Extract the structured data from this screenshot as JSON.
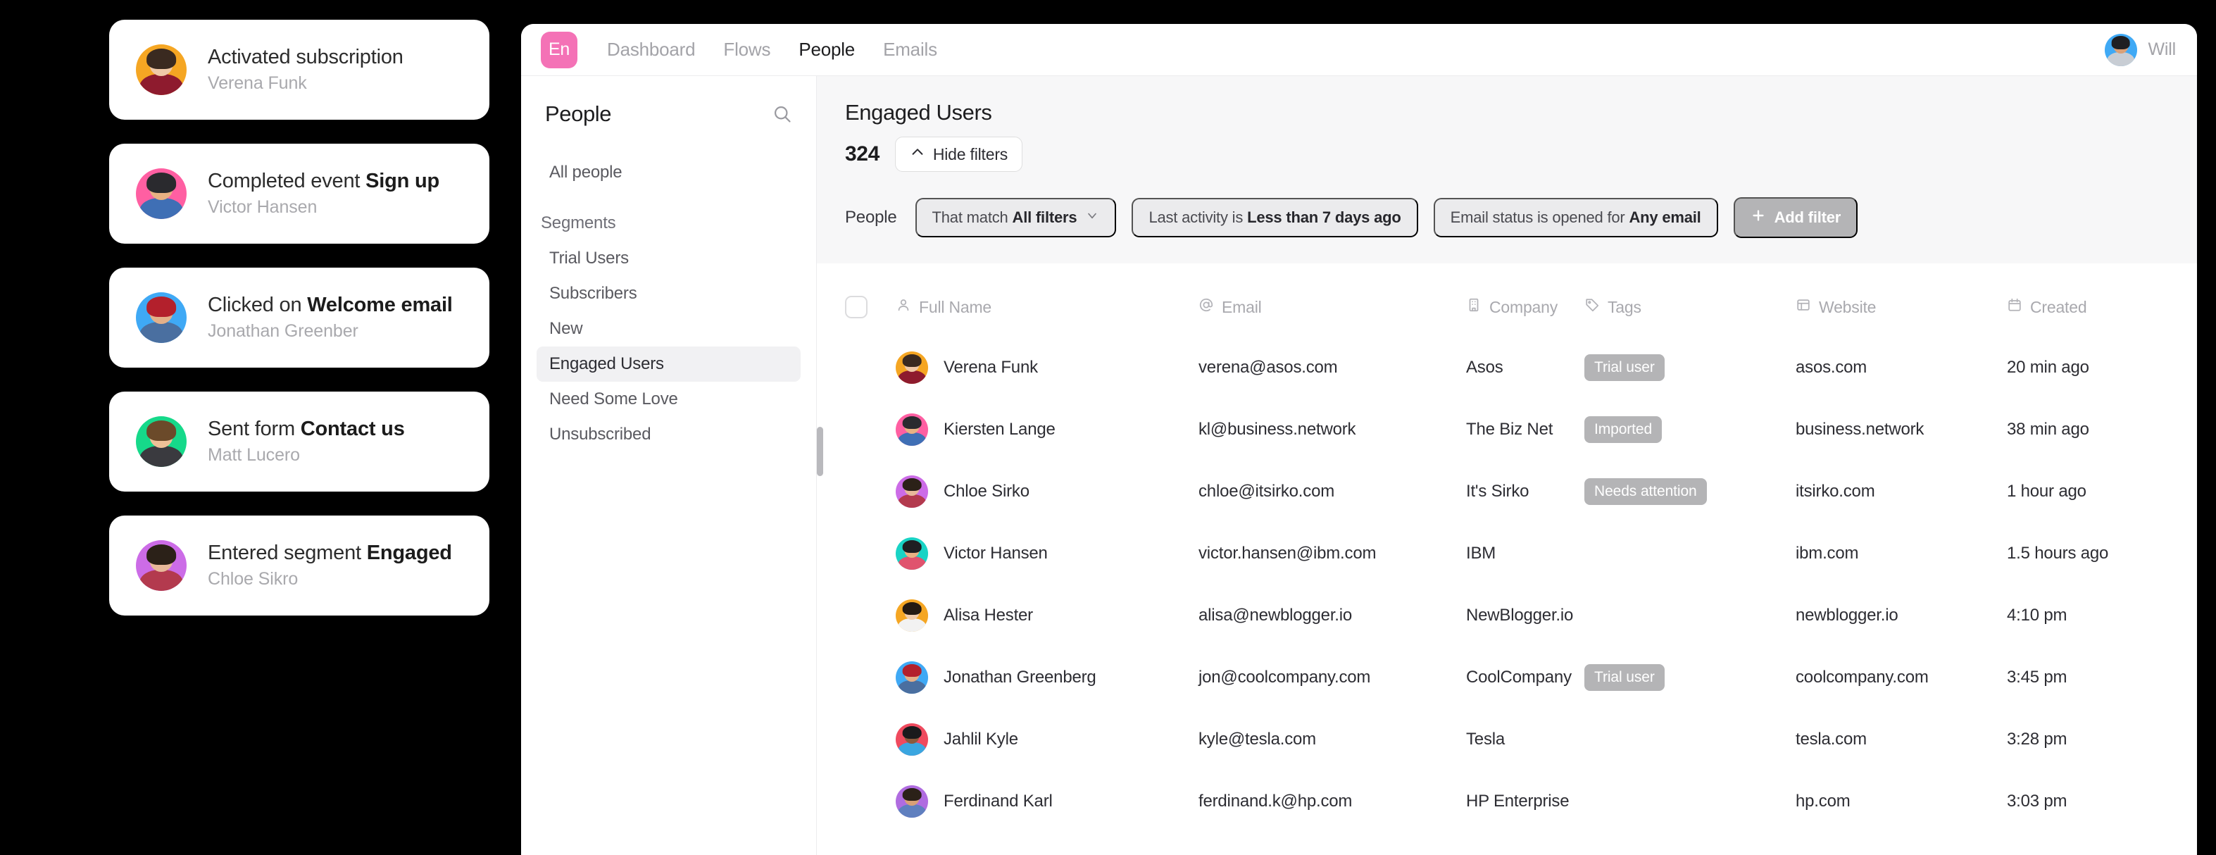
{
  "notifications": [
    {
      "action": "Activated subscription",
      "action_prefix": "Activated subscription",
      "action_bold": "",
      "person": "Verena Funk",
      "avatar": {
        "bg": "#f5a623",
        "skin": "#f0c9a8",
        "hair": "#3a2a20",
        "cloth": "#8e1b2e"
      }
    },
    {
      "action": "Completed event Sign up",
      "action_prefix": "Completed event ",
      "action_bold": "Sign up",
      "person": "Victor Hansen",
      "avatar": {
        "bg": "#ff5fa2",
        "skin": "#e8b183",
        "hair": "#2a2a2e",
        "cloth": "#3f6fb5"
      }
    },
    {
      "action": "Clicked on Welcome email",
      "action_prefix": "Clicked on ",
      "action_bold": "Welcome email",
      "person": "Jonathan Greenber",
      "avatar": {
        "bg": "#3fa9f5",
        "skin": "#e3b089",
        "hair": "#b3202c",
        "cloth": "#4a6fa0"
      }
    },
    {
      "action": "Sent form Contact us",
      "action_prefix": "Sent form ",
      "action_bold": "Contact us",
      "person": "Matt Lucero",
      "avatar": {
        "bg": "#16d98a",
        "skin": "#eec198",
        "hair": "#6b4a2a",
        "cloth": "#3a3a3f"
      }
    },
    {
      "action": "Entered segment Engaged",
      "action_prefix": "Entered segment ",
      "action_bold": "Engaged",
      "person": "Chloe Sikro",
      "avatar": {
        "bg": "#cc6ce7",
        "skin": "#e8b99a",
        "hair": "#2b2118",
        "cloth": "#b33a4e"
      }
    }
  ],
  "topnav": {
    "logo_text": "En",
    "logo_color": "#f472b6",
    "tabs": [
      {
        "label": "Dashboard",
        "active": false
      },
      {
        "label": "Flows",
        "active": false
      },
      {
        "label": "People",
        "active": true
      },
      {
        "label": "Emails",
        "active": false
      }
    ],
    "user_name": "Will",
    "user_avatar": {
      "bg": "#3fa9f5",
      "skin": "#d9a077",
      "hair": "#1f1f22",
      "cloth": "#c8cdd4"
    }
  },
  "sidebar": {
    "title": "People",
    "search_icon": "search-icon",
    "all_people": "All people",
    "segments_label": "Segments",
    "segments": [
      {
        "label": "Trial Users",
        "selected": false
      },
      {
        "label": "Subscribers",
        "selected": false
      },
      {
        "label": "New",
        "selected": false
      },
      {
        "label": "Engaged Users",
        "selected": true
      },
      {
        "label": "Need Some Love",
        "selected": false
      },
      {
        "label": "Unsubscribed",
        "selected": false
      }
    ]
  },
  "main": {
    "segment_title": "Engaged Users",
    "count": "324",
    "hide_filters_label": "Hide filters",
    "hide_filters_icon": "chevron-up-icon",
    "filters_subject": "People",
    "filters": [
      {
        "prefix": "That match ",
        "bold": "All filters",
        "suffix": "",
        "has_chevron": true
      },
      {
        "prefix": "Last activity is ",
        "bold": "Less than 7 days ago",
        "suffix": "",
        "has_chevron": false
      },
      {
        "prefix": "Email status is opened for ",
        "bold": "Any email",
        "suffix": "",
        "has_chevron": false
      }
    ],
    "add_filter_label": "Add filter",
    "add_filter_icon": "plus-icon",
    "columns": [
      {
        "label": "Full Name",
        "icon": "person-icon"
      },
      {
        "label": "Email",
        "icon": "at-icon"
      },
      {
        "label": "Company",
        "icon": "building-icon"
      },
      {
        "label": "Tags",
        "icon": "tag-icon"
      },
      {
        "label": "Website",
        "icon": "window-icon"
      },
      {
        "label": "Created",
        "icon": "calendar-icon"
      }
    ],
    "rows": [
      {
        "name": "Verena Funk",
        "email": "verena@asos.com",
        "company": "Asos",
        "tag": "Trial user",
        "website": "asos.com",
        "created": "20 min ago",
        "avatar": {
          "bg": "#f5a623",
          "skin": "#f0c9a8",
          "hair": "#3a2a20",
          "cloth": "#8e1b2e"
        }
      },
      {
        "name": "Kiersten Lange",
        "email": "kl@business.network",
        "company": "The Biz Net",
        "tag": "Imported",
        "website": "business.network",
        "created": "38 min ago",
        "avatar": {
          "bg": "#ff5fa2",
          "skin": "#e8b183",
          "hair": "#2a2a2e",
          "cloth": "#3f6fb5"
        }
      },
      {
        "name": "Chloe Sirko",
        "email": "chloe@itsirko.com",
        "company": "It's Sirko",
        "tag": "Needs attention",
        "website": "itsirko.com",
        "created": "1 hour ago",
        "avatar": {
          "bg": "#cc6ce7",
          "skin": "#e8b99a",
          "hair": "#2b2118",
          "cloth": "#b33a4e"
        }
      },
      {
        "name": "Victor Hansen",
        "email": "victor.hansen@ibm.com",
        "company": "IBM",
        "tag": "",
        "website": "ibm.com",
        "created": "1.5 hours ago",
        "avatar": {
          "bg": "#19d3c5",
          "skin": "#e8b183",
          "hair": "#1f1f22",
          "cloth": "#e0536e"
        }
      },
      {
        "name": "Alisa Hester",
        "email": "alisa@newblogger.io",
        "company": "NewBlogger.io",
        "tag": "",
        "website": "newblogger.io",
        "created": "4:10 pm",
        "avatar": {
          "bg": "#f5a623",
          "skin": "#f0cdae",
          "hair": "#241a12",
          "cloth": "#f2f2f2"
        }
      },
      {
        "name": "Jonathan Greenberg",
        "email": "jon@coolcompany.com",
        "company": "CoolCompany",
        "tag": "Trial user",
        "website": "coolcompany.com",
        "created": "3:45 pm",
        "avatar": {
          "bg": "#3fa9f5",
          "skin": "#e3b089",
          "hair": "#b3202c",
          "cloth": "#4a6fa0"
        }
      },
      {
        "name": "Jahlil Kyle",
        "email": "kyle@tesla.com",
        "company": "Tesla",
        "tag": "",
        "website": "tesla.com",
        "created": "3:28 pm",
        "avatar": {
          "bg": "#ef4a5e",
          "skin": "#8b5a3c",
          "hair": "#1a1a1c",
          "cloth": "#3aa6e0"
        }
      },
      {
        "name": "Ferdinand Karl",
        "email": "ferdinand.k@hp.com",
        "company": "HP Enterprise",
        "tag": "",
        "website": "hp.com",
        "created": "3:03 pm",
        "avatar": {
          "bg": "#b06ce0",
          "skin": "#d9a077",
          "hair": "#2b2118",
          "cloth": "#5f7fbf"
        }
      }
    ]
  },
  "colors": {
    "brand_pink": "#f472b6",
    "tag_grey": "#b4b4b6",
    "filter_band": "#f7f7f8",
    "pill_grey": "#ebebed",
    "selected_row": "#f1f1f3"
  }
}
